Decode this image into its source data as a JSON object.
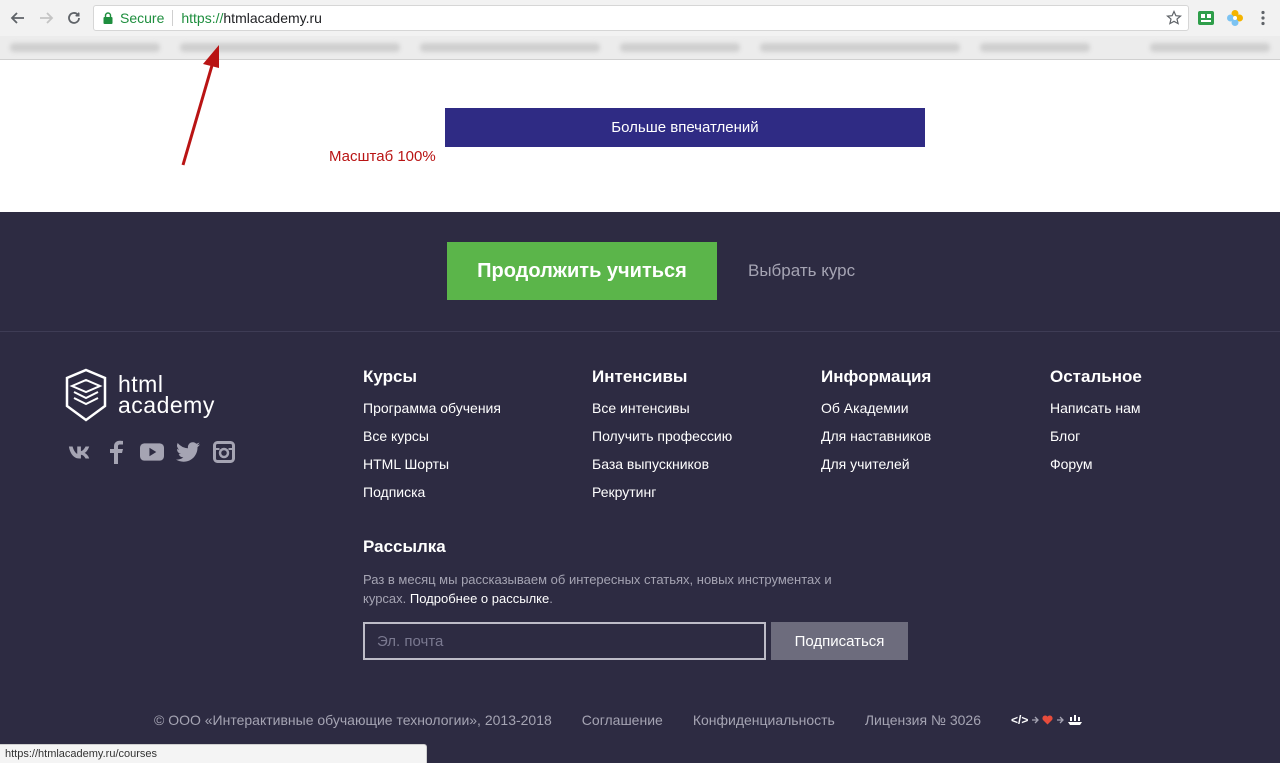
{
  "browser": {
    "secure_label": "Secure",
    "url_scheme": "https://",
    "url_host": "htmlacademy.ru",
    "status_url": "https://htmlacademy.ru/courses"
  },
  "promo": {
    "impressions_button": "Больше впечатлений",
    "zoom_note": "Масштаб 100%"
  },
  "cta": {
    "continue_label": "Продолжить учиться",
    "choose_label": "Выбрать курс"
  },
  "logo": {
    "line1": "html",
    "line2": "academy"
  },
  "socials": [
    "vk-icon",
    "facebook-icon",
    "youtube-icon",
    "twitter-icon",
    "instagram-icon"
  ],
  "columns": [
    {
      "title": "Курсы",
      "links": [
        "Программа обучения",
        "Все курсы",
        "HTML Шорты",
        "Подписка"
      ]
    },
    {
      "title": "Интенсивы",
      "links": [
        "Все интенсивы",
        "Получить профессию",
        "База выпускников",
        "Рекрутинг"
      ]
    },
    {
      "title": "Информация",
      "links": [
        "Об Академии",
        "Для наставников",
        "Для учителей"
      ]
    },
    {
      "title": "Остальное",
      "links": [
        "Написать нам",
        "Блог",
        "Форум"
      ]
    }
  ],
  "newsletter": {
    "title": "Рассылка",
    "desc": "Раз в месяц мы рассказываем об интересных статьях, новых инструментах и курсах.",
    "link": "Подробнее о рассылке",
    "link_suffix": ".",
    "email_placeholder": "Эл. почта",
    "subscribe_label": "Подписаться"
  },
  "bottom": {
    "copyright": "© ООО «Интерактивные обучающие технологии», 2013-2018",
    "agreement": "Соглашение",
    "privacy": "Конфиденциальность",
    "license": "Лицензия № 3026",
    "code_glyph": "</>"
  },
  "colors": {
    "footer_bg": "#2d2b42",
    "cta_green": "#5bb54a",
    "promo_purple": "#2f2b84",
    "annotation_red": "#b91414"
  }
}
